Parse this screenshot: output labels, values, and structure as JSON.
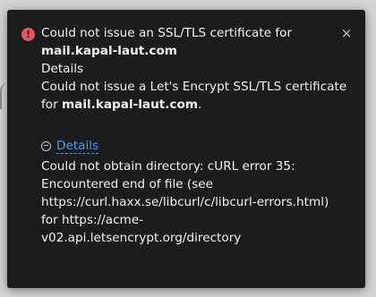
{
  "notification": {
    "icon": "error-icon",
    "icon_glyph": "!",
    "close_glyph": "×",
    "title_prefix": "Could not issue an SSL/TLS certificate for",
    "title_domain": "mail.kapal-laut.com",
    "subtitle": "Details",
    "message_line1": "Could not issue a Let's Encrypt SSL/TLS certificate",
    "message_line2_prefix": "for ",
    "message_domain": "mail.kapal-laut.com",
    "message_suffix": ".",
    "details_toggle_label": "Details",
    "details_lines": [
      "Could not obtain directory: cURL error 35:",
      "Encountered end of file (see",
      "https://curl.haxx.se/libcurl/c/libcurl-errors.html)",
      "for https://acme-",
      "v02.api.letsencrypt.org/directory"
    ]
  },
  "colors": {
    "background": "#d2d3d4",
    "toast_background": "#1b1c1d",
    "error_icon": "#e7555f",
    "link": "#4b9cf2",
    "text": "#f1f1f1"
  }
}
